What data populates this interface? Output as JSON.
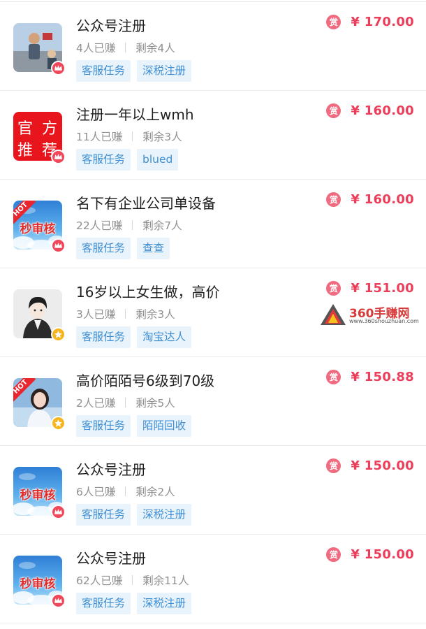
{
  "tasks": [
    {
      "title": "公众号注册",
      "earned": "4人已赚",
      "remaining": "剩余4人",
      "tags": [
        "客服任务",
        "深税注册"
      ],
      "price": "¥ 170.00",
      "reward_icon": "赏",
      "thumb": "photo",
      "badge": "red"
    },
    {
      "title": "注册一年以上wmh",
      "earned": "11人已赚",
      "remaining": "剩余3人",
      "tags": [
        "客服任务",
        "blued"
      ],
      "price": "¥ 160.00",
      "reward_icon": "赏",
      "thumb": "official",
      "thumb_text": [
        "官",
        "方",
        "推",
        "荐"
      ],
      "badge": "red"
    },
    {
      "title": "名下有企业公司单设备",
      "earned": "22人已赚",
      "remaining": "剩余7人",
      "tags": [
        "客服任务",
        "查查"
      ],
      "price": "¥ 160.00",
      "reward_icon": "赏",
      "thumb": "sky",
      "thumb_hot": "HOT",
      "thumb_text": "秒审核",
      "badge": "red"
    },
    {
      "title": "16岁以上女生做，高价",
      "earned": "3人已赚",
      "remaining": "剩余3人",
      "tags": [
        "客服任务",
        "淘宝达人"
      ],
      "price": "¥ 151.00",
      "reward_icon": "赏",
      "thumb": "avatar",
      "badge": "gold"
    },
    {
      "title": "高价陌陌号6级到70级",
      "earned": "2人已赚",
      "remaining": "剩余5人",
      "tags": [
        "客服任务",
        "陌陌回收"
      ],
      "price": "¥ 150.88",
      "reward_icon": "赏",
      "thumb": "girl",
      "thumb_hot": "HOT",
      "badge": "gold"
    },
    {
      "title": "公众号注册",
      "earned": "6人已赚",
      "remaining": "剩余2人",
      "tags": [
        "客服任务",
        "深税注册"
      ],
      "price": "¥ 150.00",
      "reward_icon": "赏",
      "thumb": "sky",
      "thumb_text": "秒审核",
      "badge": "red"
    },
    {
      "title": "公众号注册",
      "earned": "62人已赚",
      "remaining": "剩余11人",
      "tags": [
        "客服任务",
        "深税注册"
      ],
      "price": "¥ 150.00",
      "reward_icon": "赏",
      "thumb": "sky",
      "thumb_text": "秒审核",
      "badge": "red"
    }
  ],
  "watermark": {
    "text": "360手赚网",
    "url": "www.360shouzhuan.com"
  },
  "colors": {
    "price": "#ec3d5a",
    "tag_bg": "#e9f3fc",
    "tag_text": "#3f8fd2",
    "badge_red": "#f0475a",
    "badge_gold": "#f6b51e"
  }
}
